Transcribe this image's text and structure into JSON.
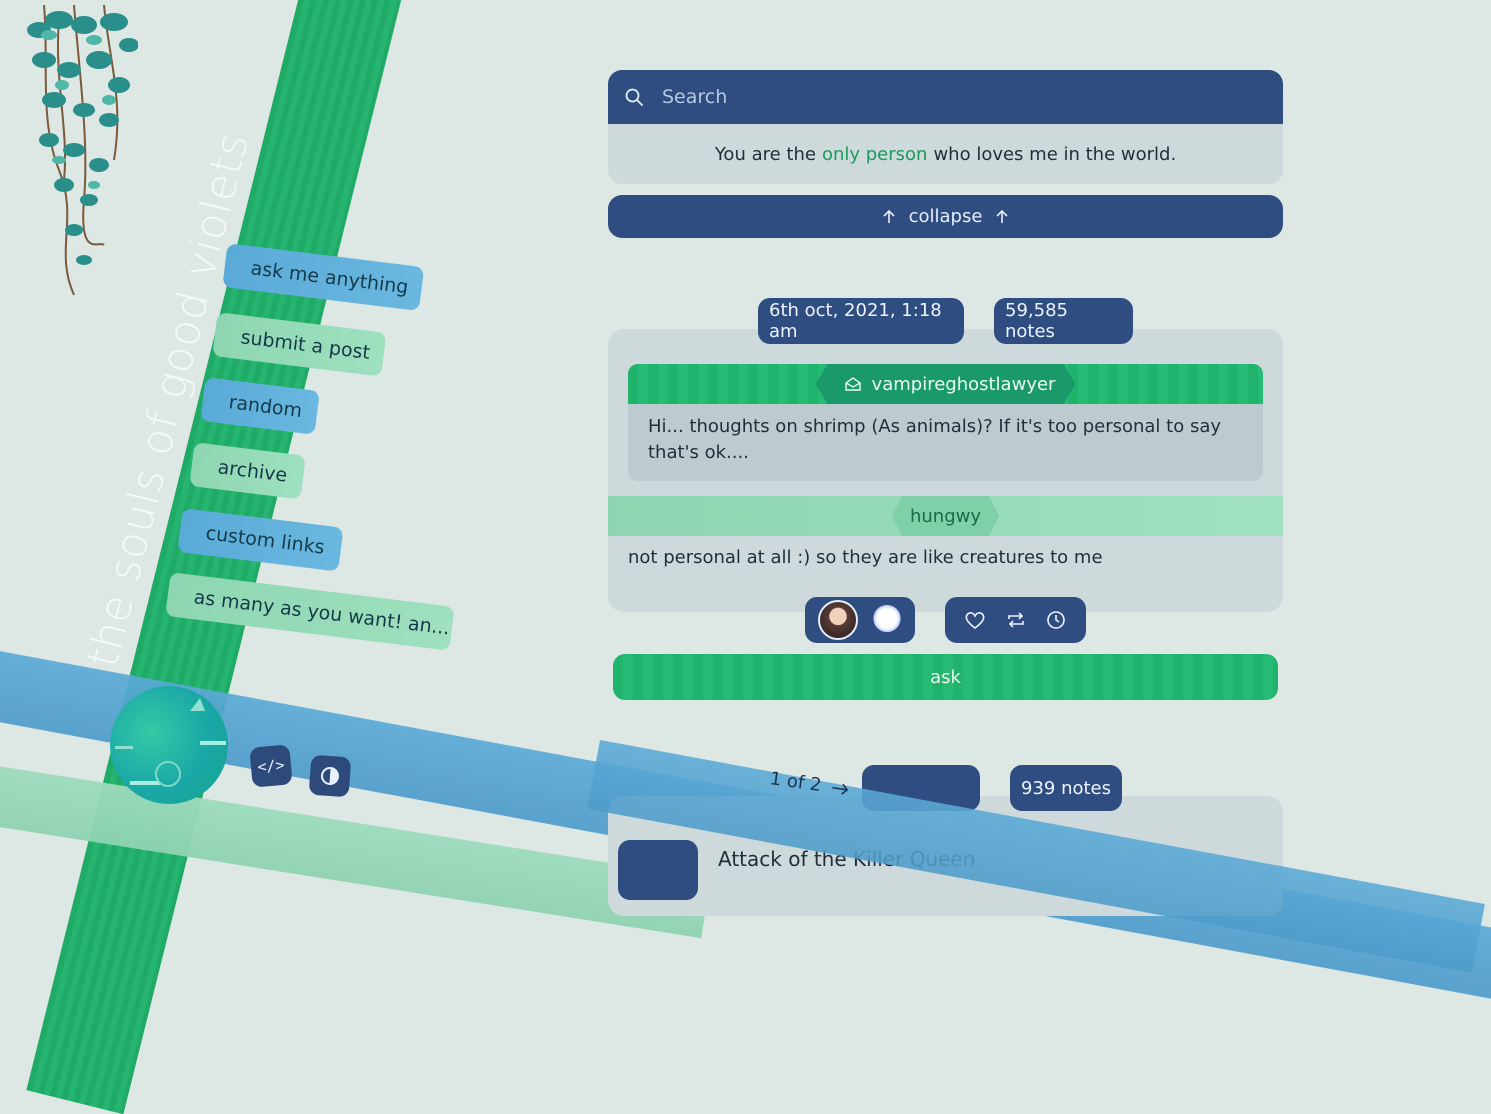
{
  "blog": {
    "title": "the souls of good violets"
  },
  "nav": {
    "links": [
      {
        "label": "ask me anything"
      },
      {
        "label": "submit a post"
      },
      {
        "label": "random"
      },
      {
        "label": "archive"
      },
      {
        "label": "custom links"
      },
      {
        "label": "as many as you want! an..."
      }
    ]
  },
  "search": {
    "placeholder": "Search"
  },
  "description": {
    "before": "You are the",
    "highlight": "only person",
    "after": "who loves me in the world."
  },
  "collapse": {
    "label": "collapse"
  },
  "post": {
    "date": "6th oct, 2021, 1:18 am",
    "notes": "59,585 notes",
    "asker": "vampireghostlawyer",
    "question": "Hi... thoughts on shrimp (As animals)? If it's too personal to say that's ok....",
    "answerer": "hungwy",
    "answer": "not personal at all :) so they are like creatures to me",
    "tag": "ask"
  },
  "next_post": {
    "notes": "939 notes",
    "title": "Attack of the Killer Queen"
  },
  "pagination": {
    "label": "1 of 2"
  },
  "colors": {
    "accent_green": "#1fb36c",
    "navy": "#2f4d80",
    "background": "#dde7e4"
  },
  "icons": {
    "search": "search-icon",
    "arrow_up": "arrow-up-icon",
    "envelope": "envelope-icon",
    "like": "heart-icon",
    "reblog": "reblog-icon",
    "queue": "clock-icon",
    "code": "code-icon",
    "theme": "contrast-icon",
    "next": "arrow-right-icon"
  }
}
